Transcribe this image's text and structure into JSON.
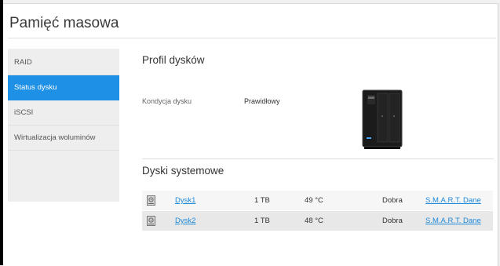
{
  "page": {
    "title": "Pamięć masowa"
  },
  "sidebar": {
    "items": [
      {
        "label": "RAID"
      },
      {
        "label": "Status dysku"
      },
      {
        "label": "iSCSI"
      },
      {
        "label": "Wirtualizacja woluminów"
      }
    ]
  },
  "profile": {
    "title": "Profil dysków",
    "condition_label": "Kondycja dysku",
    "condition_value": "Prawidłowy",
    "device_icon": "nas-device-image"
  },
  "system_disks": {
    "title": "Dyski systemowe",
    "rows": [
      {
        "name": "Dysk1",
        "size": "1 TB",
        "temp": "49 °C",
        "status": "Dobra",
        "smart": "S.M.A.R.T. Dane"
      },
      {
        "name": "Dysk2",
        "size": "1 TB",
        "temp": "48 °C",
        "status": "Dobra",
        "smart": "S.M.A.R.T. Dane"
      }
    ]
  },
  "colors": {
    "accent": "#1e90e6",
    "link": "#1e88d9"
  }
}
